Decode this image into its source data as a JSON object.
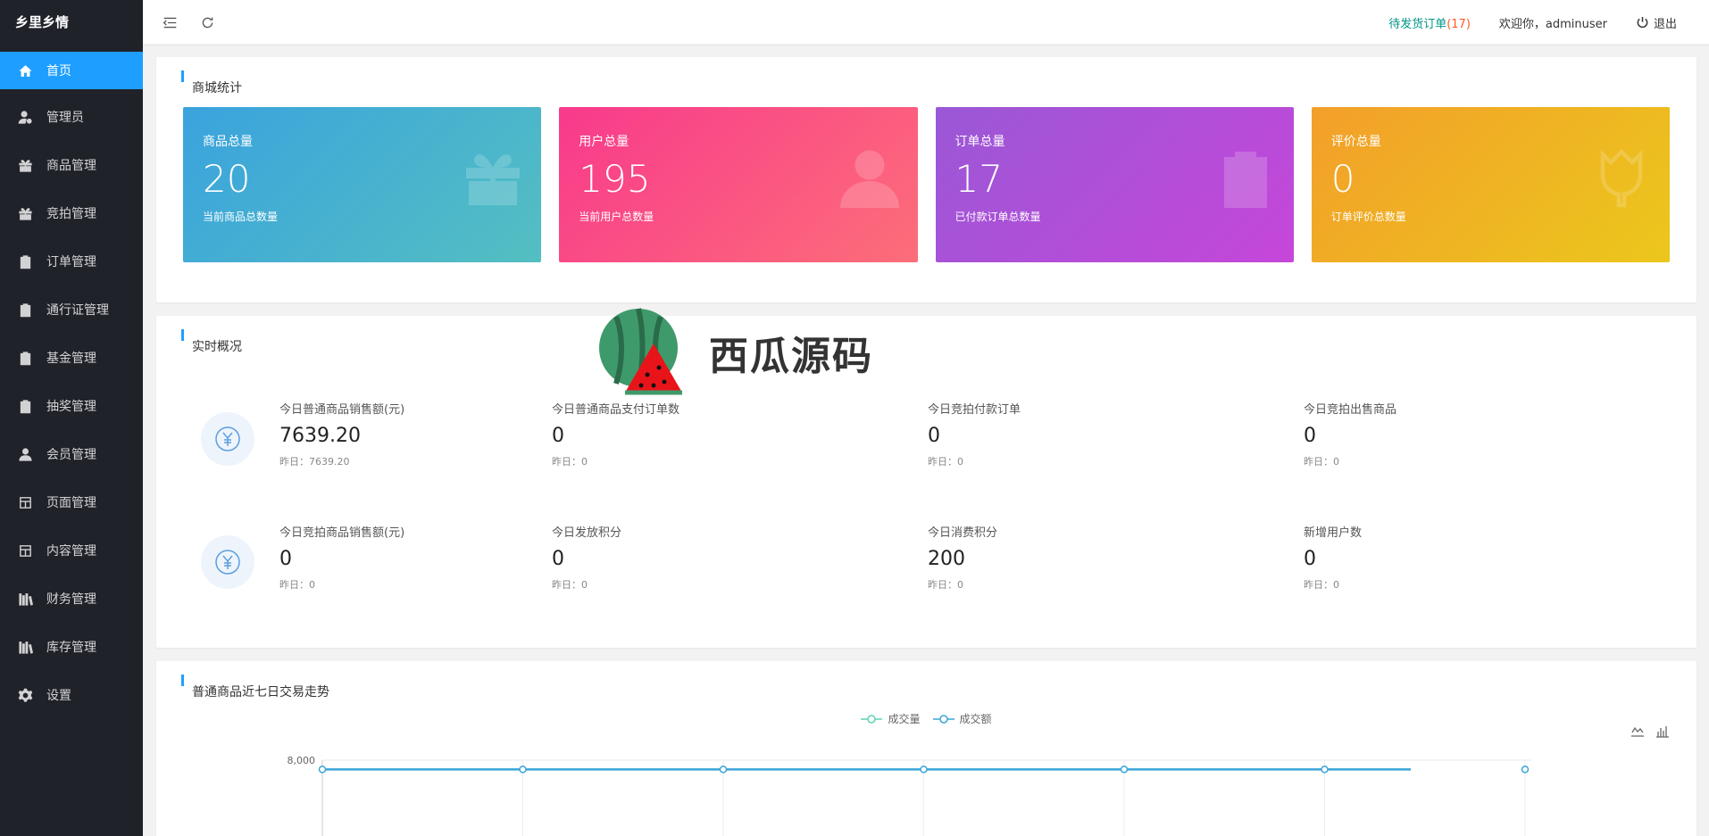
{
  "app": {
    "logo": "乡里乡情"
  },
  "sidebar": {
    "items": [
      {
        "label": "首页",
        "icon": "home-icon",
        "active": true
      },
      {
        "label": "管理员",
        "icon": "admin-user-icon"
      },
      {
        "label": "商品管理",
        "icon": "gift-icon"
      },
      {
        "label": "竞拍管理",
        "icon": "gift-icon"
      },
      {
        "label": "订单管理",
        "icon": "clipboard-icon"
      },
      {
        "label": "通行证管理",
        "icon": "clipboard-icon"
      },
      {
        "label": "基金管理",
        "icon": "clipboard-icon"
      },
      {
        "label": "抽奖管理",
        "icon": "clipboard-icon"
      },
      {
        "label": "会员管理",
        "icon": "user-icon"
      },
      {
        "label": "页面管理",
        "icon": "layout-icon"
      },
      {
        "label": "内容管理",
        "icon": "layout-icon"
      },
      {
        "label": "财务管理",
        "icon": "books-icon"
      },
      {
        "label": "库存管理",
        "icon": "books-icon"
      },
      {
        "label": "设置",
        "icon": "gear-icon"
      }
    ]
  },
  "header": {
    "pending_label": "待发货订单",
    "pending_count": "(17)",
    "welcome": "欢迎你，adminuser",
    "logout": "退出"
  },
  "shop_stats": {
    "title": "商城统计",
    "cards": [
      {
        "label": "商品总量",
        "value": "20",
        "sub": "当前商品总数量",
        "icon": "gift-icon"
      },
      {
        "label": "用户总量",
        "value": "195",
        "sub": "当前用户总数量",
        "icon": "user-icon"
      },
      {
        "label": "订单总量",
        "value": "17",
        "sub": "已付款订单总数量",
        "icon": "clipboard-icon"
      },
      {
        "label": "评价总量",
        "value": "0",
        "sub": "订单评价总数量",
        "icon": "tulip-icon"
      }
    ]
  },
  "realtime": {
    "title": "实时概况",
    "rows": [
      [
        {
          "label": "今日普通商品销售额(元)",
          "value": "7639.20",
          "prev": "昨日：7639.20"
        },
        {
          "label": "今日普通商品支付订单数",
          "value": "0",
          "prev": "昨日：0"
        },
        {
          "label": "今日竞拍付款订单",
          "value": "0",
          "prev": "昨日：0"
        },
        {
          "label": "今日竞拍出售商品",
          "value": "0",
          "prev": "昨日：0"
        }
      ],
      [
        {
          "label": "今日竞拍商品销售额(元)",
          "value": "0",
          "prev": "昨日：0"
        },
        {
          "label": "今日发放积分",
          "value": "0",
          "prev": "昨日：0"
        },
        {
          "label": "今日消费积分",
          "value": "200",
          "prev": "昨日：0"
        },
        {
          "label": "新增用户数",
          "value": "0",
          "prev": "昨日：0"
        }
      ]
    ]
  },
  "trend": {
    "title": "普通商品近七日交易走势",
    "legend": [
      "成交量",
      "成交额"
    ],
    "colors": {
      "volume": "#5fd3b3",
      "amount": "#3ba4d8"
    }
  },
  "chart_data": {
    "type": "line",
    "title": "普通商品近七日交易走势",
    "series": [
      {
        "name": "成交量",
        "values": []
      },
      {
        "name": "成交额",
        "values": [
          7639.2,
          7639.2,
          7639.2,
          7639.2,
          7639.2,
          7639.2,
          7639.2
        ]
      }
    ],
    "y_ticks": [
      "8,000"
    ],
    "ylim": [
      0,
      8000
    ],
    "grid": true,
    "legend_position": "top-center"
  },
  "watermark": {
    "text": "西瓜源码"
  }
}
